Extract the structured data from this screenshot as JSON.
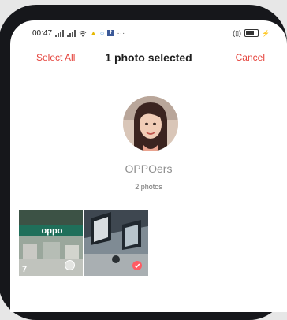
{
  "status_bar": {
    "time": "00:47",
    "network_label": "4G",
    "more": "···"
  },
  "header": {
    "select_all": "Select All",
    "title": "1 photo selected",
    "cancel": "Cancel"
  },
  "album": {
    "name": "OPPOers",
    "count": "2 photos"
  },
  "photos": [
    {
      "id": "photo-1",
      "selected": false,
      "partial_digit": "7",
      "sign_text": "oppo"
    },
    {
      "id": "photo-2",
      "selected": true
    }
  ],
  "colors": {
    "accent": "#e5433c",
    "check": "#ff5b63"
  }
}
